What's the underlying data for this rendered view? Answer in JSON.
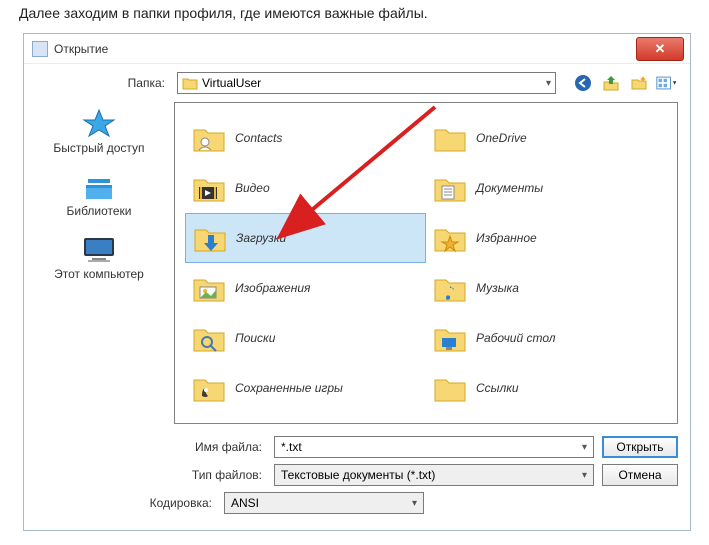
{
  "caption": "Далее заходим в папки профиля, где имеются важные файлы.",
  "dialog": {
    "title": "Открытие"
  },
  "folder_row": {
    "label": "Папка:",
    "value": "VirtualUser"
  },
  "sidebar": {
    "items": [
      {
        "label": "Быстрый доступ",
        "icon": "star-icon"
      },
      {
        "label": "Библиотеки",
        "icon": "libraries-icon"
      },
      {
        "label": "Этот компьютер",
        "icon": "computer-icon"
      }
    ]
  },
  "files": {
    "col1": [
      {
        "label": "Contacts",
        "icon": "folder-contacts"
      },
      {
        "label": "Видео",
        "icon": "folder-video"
      },
      {
        "label": "Загрузки",
        "icon": "folder-downloads",
        "selected": true
      },
      {
        "label": "Изображения",
        "icon": "folder-pictures"
      },
      {
        "label": "Поиски",
        "icon": "folder-search"
      },
      {
        "label": "Сохраненные игры",
        "icon": "folder-games"
      }
    ],
    "col2": [
      {
        "label": "OneDrive",
        "icon": "folder-onedrive"
      },
      {
        "label": "Документы",
        "icon": "folder-documents"
      },
      {
        "label": "Избранное",
        "icon": "folder-favorites"
      },
      {
        "label": "Музыка",
        "icon": "folder-music"
      },
      {
        "label": "Рабочий стол",
        "icon": "folder-desktop"
      },
      {
        "label": "Ссылки",
        "icon": "folder-links"
      }
    ]
  },
  "bottom": {
    "filename_label": "Имя файла:",
    "filename_value": "*.txt",
    "filetype_label": "Тип файлов:",
    "filetype_value": "Текстовые документы (*.txt)",
    "encoding_label": "Кодировка:",
    "encoding_value": "ANSI",
    "open_btn": "Открыть",
    "cancel_btn": "Отмена"
  },
  "toolbar_icons": [
    "back-icon",
    "up-icon",
    "new-folder-icon",
    "views-icon"
  ]
}
